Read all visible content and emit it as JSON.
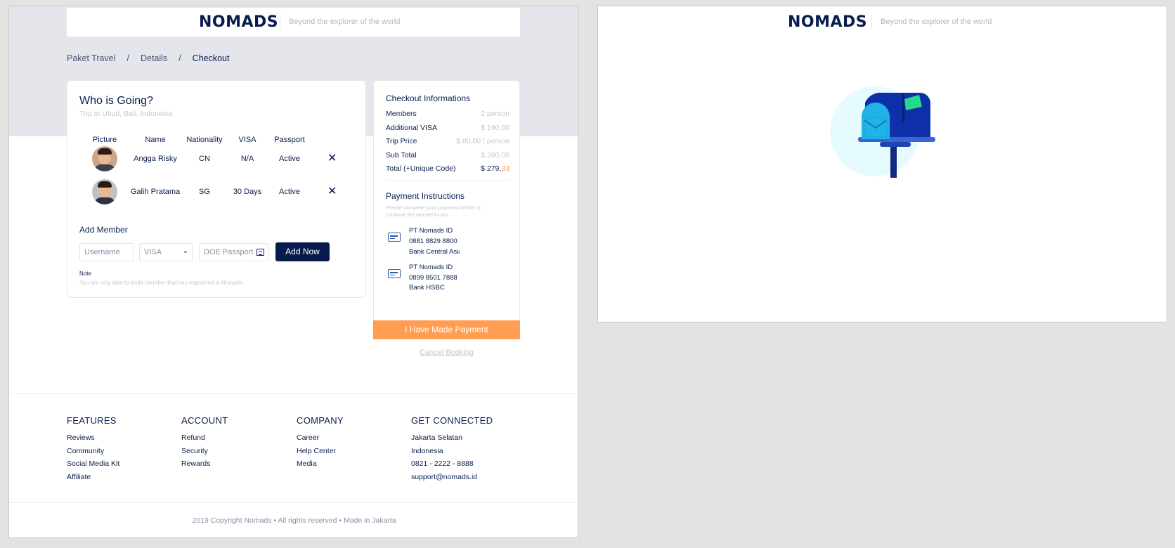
{
  "brand": {
    "logo": "NOMADS",
    "tagline": "Beyond the explorer of the world"
  },
  "breadcrumb": [
    "Paket Travel",
    "Details",
    "Checkout"
  ],
  "members_card": {
    "title": "Who is Going?",
    "subtitle": "Trip to Ubud, Bali, Indonesia",
    "columns": [
      "Picture",
      "Name",
      "Nationality",
      "VISA",
      "Passport"
    ],
    "rows": [
      {
        "name": "Angga Risky",
        "nationality": "CN",
        "visa": "N/A",
        "passport": "Active"
      },
      {
        "name": "Galih Pratama",
        "nationality": "SG",
        "visa": "30 Days",
        "passport": "Active"
      }
    ],
    "remove_icon": "close-icon",
    "add_member": {
      "label": "Add Member",
      "username_placeholder": "Username",
      "visa_selected": "VISA",
      "doe_placeholder": "DOE Passport",
      "button": "Add Now"
    },
    "note_title": "Note",
    "note_text": "You are only able to invite member that has registered in Nomads."
  },
  "checkout": {
    "title": "Checkout Informations",
    "rows": [
      {
        "label": "Members",
        "value": "2 person"
      },
      {
        "label": "Additional VISA",
        "value": "$ 190,00"
      },
      {
        "label": "Trip Price",
        "value": "$ 80,00 / person"
      },
      {
        "label": "Sub Total",
        "value": "$ 280,00"
      }
    ],
    "total": {
      "label": "Total (+Unique Code)",
      "value_main": "$ 279,",
      "value_code": "33"
    },
    "payment_title": "Payment Instructions",
    "payment_text": "Please complete your payment before to continue the wonderful trip",
    "banks": [
      {
        "lines": [
          "PT Nomads ID",
          "0881 8829 8800",
          "Bank Central Asia"
        ]
      },
      {
        "lines": [
          "PT Nomads ID",
          "0899 8501 7888",
          "Bank HSBC"
        ]
      }
    ],
    "confirm_button": "I Have Made Payment",
    "cancel_link": "Cancel Booking"
  },
  "footer": {
    "columns": [
      {
        "head": "FEATURES",
        "links": [
          "Reviews",
          "Community",
          "Social Media Kit",
          "Affiliate"
        ]
      },
      {
        "head": "ACCOUNT",
        "links": [
          "Refund",
          "Security",
          "Rewards"
        ]
      },
      {
        "head": "COMPANY",
        "links": [
          "Career",
          "Help Center",
          "Media"
        ]
      },
      {
        "head": "GET CONNECTED",
        "links": [
          "Jakarta Selatan",
          "Indonesia",
          "0821 - 2222 - 8888",
          "support@nomads.id"
        ]
      }
    ],
    "copyright": "2019 Copyright Nomads • All rights reserved • Made in Jakarta"
  },
  "colors": {
    "navy": "#071c4d",
    "orange": "#ff9e53",
    "band": "#e4e6ec",
    "muted": "#c4c7d1"
  }
}
